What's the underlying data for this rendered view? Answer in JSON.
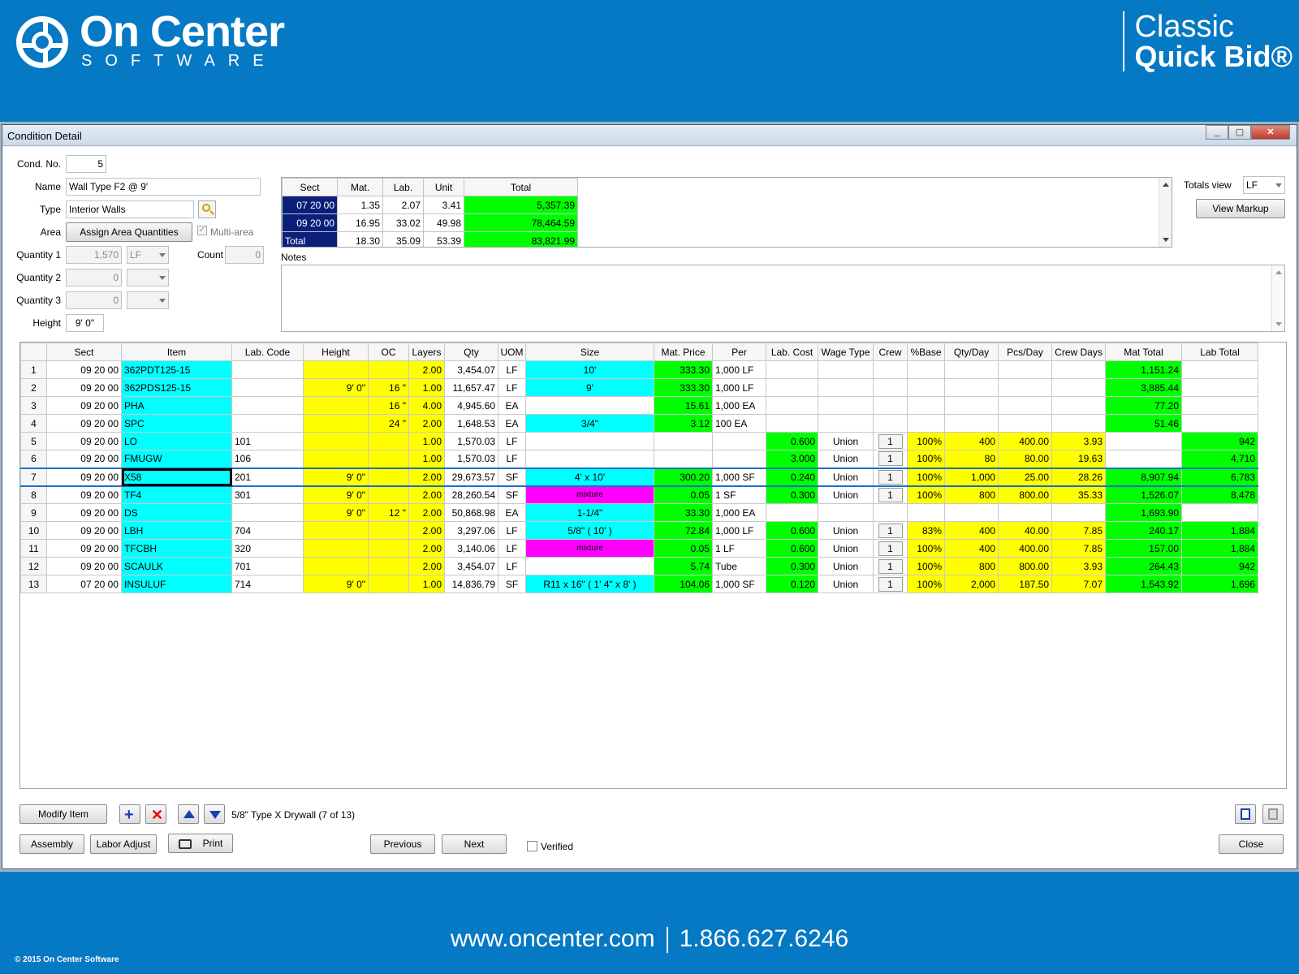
{
  "brand": {
    "name": "On Center",
    "sub": "SOFTWARE",
    "product_l1": "Classic",
    "product_l2": "Quick Bid®"
  },
  "footer": {
    "url": "www.oncenter.com",
    "phone": "1.866.627.6246",
    "copyright": "© 2015 On Center Software"
  },
  "window": {
    "title": "Condition Detail",
    "min": "_",
    "max": "▢",
    "close": "✕"
  },
  "form": {
    "cond_no_label": "Cond. No.",
    "cond_no": "5",
    "name_label": "Name",
    "name": "Wall Type F2 @ 9'",
    "type_label": "Type",
    "type": "Interior Walls",
    "area_label": "Area",
    "assign_area_button": "Assign Area Quantities",
    "multi_area": "Multi-area",
    "q1_label": "Quantity 1",
    "q1": "1,570",
    "q1_uom": "LF",
    "count_label": "Count",
    "count": "0",
    "q2_label": "Quantity 2",
    "q2": "0",
    "q3_label": "Quantity 3",
    "q3": "0",
    "height_label": "Height",
    "height": "9' 0\""
  },
  "totals": {
    "headers": [
      "Sect",
      "Mat.",
      "Lab.",
      "Unit",
      "Total"
    ],
    "rows": [
      [
        "07 20 00",
        "1.35",
        "2.07",
        "3.41",
        "5,357.39"
      ],
      [
        "09 20 00",
        "16.95",
        "33.02",
        "49.98",
        "78,464.59"
      ],
      [
        "Total",
        "18.30",
        "35.09",
        "53.39",
        "83,821.99"
      ]
    ],
    "view_label": "Totals view",
    "view_value": "LF",
    "view_markup": "View Markup"
  },
  "notes_label": "Notes",
  "grid": {
    "headers": [
      "",
      "Sect",
      "Item",
      "Lab. Code",
      "Height",
      "OC",
      "Layers",
      "Qty",
      "UOM",
      "Size",
      "Mat. Price",
      "Per",
      "Lab. Cost",
      "Wage Type",
      "Crew",
      "%Base",
      "Qty/Day",
      "Pcs/Day",
      "Crew Days",
      "Mat Total",
      "Lab Total"
    ],
    "rows": [
      [
        "1",
        "09 20 00",
        "362PDT125-15",
        "",
        "",
        "",
        "2.00",
        "3,454.07",
        "LF",
        "10'",
        "333.30",
        "1,000 LF",
        "",
        "",
        "",
        "",
        "",
        "",
        "",
        "1,151.24",
        ""
      ],
      [
        "2",
        "09 20 00",
        "362PDS125-15",
        "",
        "9' 0\"",
        "16 \"",
        "1.00",
        "11,657.47",
        "LF",
        "9'",
        "333.30",
        "1,000 LF",
        "",
        "",
        "",
        "",
        "",
        "",
        "",
        "3,885.44",
        ""
      ],
      [
        "3",
        "09 20 00",
        "PHA",
        "",
        "",
        "16 \"",
        "4.00",
        "4,945.60",
        "EA",
        "",
        "15.61",
        "1,000 EA",
        "",
        "",
        "",
        "",
        "",
        "",
        "",
        "77.20",
        ""
      ],
      [
        "4",
        "09 20 00",
        "SPC",
        "",
        "",
        "24 \"",
        "2.00",
        "1,648.53",
        "EA",
        "3/4\"",
        "3.12",
        "100 EA",
        "",
        "",
        "",
        "",
        "",
        "",
        "",
        "51.46",
        ""
      ],
      [
        "5",
        "09 20 00",
        "LO",
        "101",
        "",
        "",
        "1.00",
        "1,570.03",
        "LF",
        "",
        "",
        "",
        "0.600",
        "Union",
        "1",
        "100%",
        "400",
        "400.00",
        "3.93",
        "",
        "942"
      ],
      [
        "6",
        "09 20 00",
        "FMUGW",
        "106",
        "",
        "",
        "1.00",
        "1,570.03",
        "LF",
        "",
        "",
        "",
        "3.000",
        "Union",
        "1",
        "100%",
        "80",
        "80.00",
        "19.63",
        "",
        "4,710"
      ],
      [
        "7",
        "09 20 00",
        "X58",
        "201",
        "9' 0\"",
        "",
        "2.00",
        "29,673.57",
        "SF",
        "4' x 10'",
        "300.20",
        "1,000 SF",
        "0.240",
        "Union",
        "1",
        "100%",
        "1,000",
        "25.00",
        "28.26",
        "8,907.94",
        "6,783"
      ],
      [
        "8",
        "09 20 00",
        "TF4",
        "301",
        "9' 0\"",
        "",
        "2.00",
        "28,260.54",
        "SF",
        "mixture",
        "0.05",
        "1 SF",
        "0.300",
        "Union",
        "1",
        "100%",
        "800",
        "800.00",
        "35.33",
        "1,526.07",
        "8,478"
      ],
      [
        "9",
        "09 20 00",
        "DS",
        "",
        "9' 0\"",
        "12 \"",
        "2.00",
        "50,868.98",
        "EA",
        "1-1/4\"",
        "33.30",
        "1,000 EA",
        "",
        "",
        "",
        "",
        "",
        "",
        "",
        "1,693.90",
        ""
      ],
      [
        "10",
        "09 20 00",
        "LBH",
        "704",
        "",
        "",
        "2.00",
        "3,297.06",
        "LF",
        "5/8\" ( 10' )",
        "72.84",
        "1,000 LF",
        "0.600",
        "Union",
        "1",
        "83%",
        "400",
        "40.00",
        "7.85",
        "240.17",
        "1,884"
      ],
      [
        "11",
        "09 20 00",
        "TFCBH",
        "320",
        "",
        "",
        "2.00",
        "3,140.06",
        "LF",
        "mixture",
        "0.05",
        "1 LF",
        "0.600",
        "Union",
        "1",
        "100%",
        "400",
        "400.00",
        "7.85",
        "157.00",
        "1,884"
      ],
      [
        "12",
        "09 20 00",
        "SCAULK",
        "701",
        "",
        "",
        "2.00",
        "3,454.07",
        "LF",
        "",
        "5.74",
        "Tube",
        "0.300",
        "Union",
        "1",
        "100%",
        "800",
        "800.00",
        "3.93",
        "264.43",
        "942"
      ],
      [
        "13",
        "07 20 00",
        "INSULUF",
        "714",
        "9' 0\"",
        "",
        "1.00",
        "14,836.79",
        "SF",
        "R11 x 16\" ( 1' 4\" x 8' )",
        "104.06",
        "1,000 SF",
        "0.120",
        "Union",
        "1",
        "100%",
        "2,000",
        "187.50",
        "7.07",
        "1,543.92",
        "1,696"
      ]
    ]
  },
  "toolbar": {
    "modify_item": "Modify Item",
    "status": "5/8\" Type X Drywall (7 of 13)",
    "assembly": "Assembly",
    "labor_adjust": "Labor Adjust",
    "print": "Print",
    "previous": "Previous",
    "next": "Next",
    "verified": "Verified",
    "close": "Close"
  },
  "colors": {
    "yellow": "#ffff00",
    "cyan": "#00ffff",
    "green": "#00ff00",
    "magenta": "#ff00ff",
    "banner": "#0579c3"
  }
}
